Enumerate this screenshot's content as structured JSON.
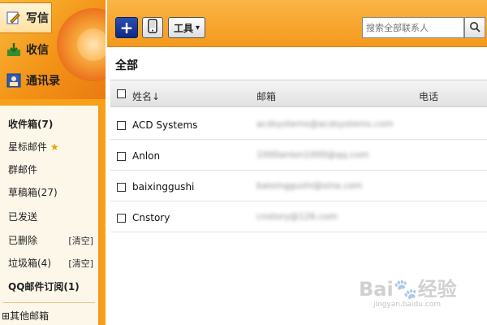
{
  "sidebar": {
    "actions": [
      {
        "label": "写信",
        "icon": "pencil-icon"
      },
      {
        "label": "收信",
        "icon": "inbox-download-icon"
      },
      {
        "label": "通讯录",
        "icon": "contacts-icon"
      }
    ],
    "folders": [
      {
        "label": "收件箱(7)"
      },
      {
        "label": "星标邮件"
      },
      {
        "label": "群邮件"
      },
      {
        "label": "草稿箱(27)"
      },
      {
        "label": "已发送"
      },
      {
        "label": "已删除",
        "action": "[清空]"
      },
      {
        "label": "垃圾箱(4)",
        "action": "[清空]"
      },
      {
        "label": "QQ邮件订阅(1)"
      },
      {
        "label": "其他邮箱",
        "prefix": "⊞"
      }
    ],
    "star": "★"
  },
  "toolbar": {
    "add_label": "+",
    "tools_label": "工具",
    "tools_arrow": "▾",
    "search_placeholder": "搜索全部联系人"
  },
  "main": {
    "section_title": "全部",
    "columns": {
      "name": "姓名↓",
      "email": "邮箱",
      "phone": "电话"
    },
    "contacts": [
      {
        "name": "ACD Systems",
        "email": "acdsystems@acdsystems.com"
      },
      {
        "name": "Anlon",
        "email": "1000anlon1000@qq.com"
      },
      {
        "name": "baixinggushi",
        "email": "baixinggushi@sina.com"
      },
      {
        "name": "Cnstory",
        "email": "cnstory@126.com"
      }
    ]
  },
  "watermark": {
    "text": "Bai🐾经验",
    "sub": "jingyan.baidu.com"
  },
  "colors": {
    "accent": "#f49a1d",
    "sidebar_bg": "#fdf7ea",
    "add_button": "#1a3a9a"
  }
}
